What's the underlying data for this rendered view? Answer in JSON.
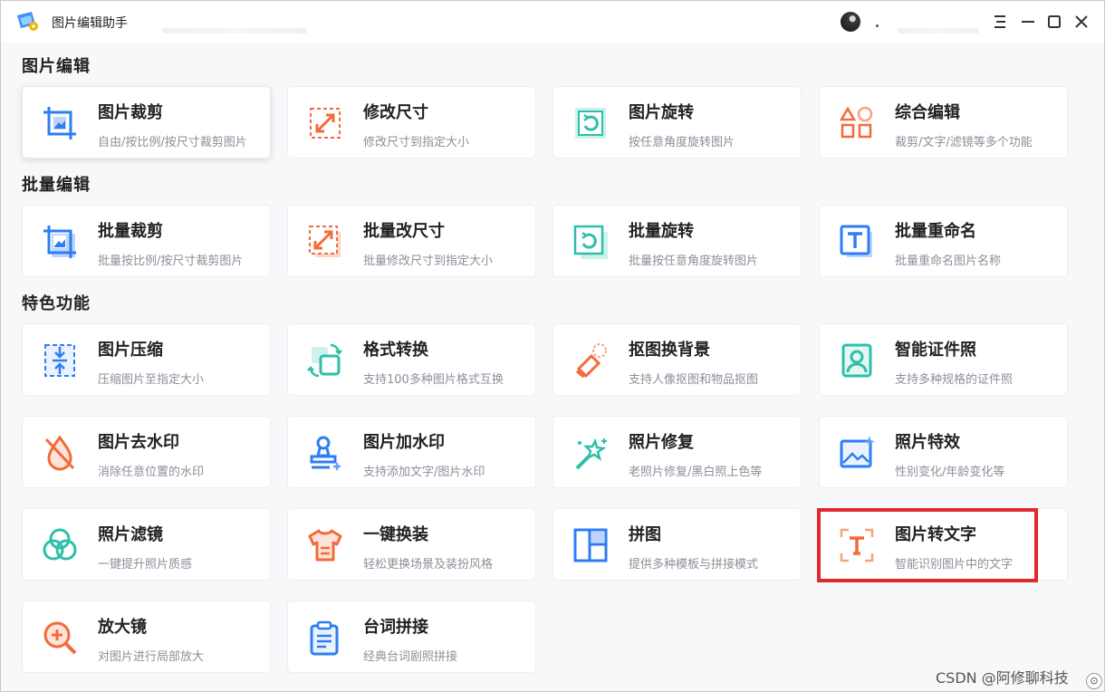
{
  "app": {
    "title": "图片编辑助手"
  },
  "sections": {
    "edit": "图片编辑",
    "batch": "批量编辑",
    "feature": "特色功能"
  },
  "cards": {
    "crop": {
      "title": "图片裁剪",
      "desc": "自由/按比例/按尺寸裁剪图片"
    },
    "resize": {
      "title": "修改尺寸",
      "desc": "修改尺寸到指定大小"
    },
    "rotate": {
      "title": "图片旋转",
      "desc": "按任意角度旋转图片"
    },
    "combo": {
      "title": "综合编辑",
      "desc": "裁剪/文字/滤镜等多个功能"
    },
    "batch_crop": {
      "title": "批量裁剪",
      "desc": "批量按比例/按尺寸裁剪图片"
    },
    "batch_resize": {
      "title": "批量改尺寸",
      "desc": "批量修改尺寸到指定大小"
    },
    "batch_rotate": {
      "title": "批量旋转",
      "desc": "批量按任意角度旋转图片"
    },
    "batch_rename": {
      "title": "批量重命名",
      "desc": "批量重命名图片名称"
    },
    "compress": {
      "title": "图片压缩",
      "desc": "压缩图片至指定大小"
    },
    "convert": {
      "title": "格式转换",
      "desc": "支持100多种图片格式互换"
    },
    "cutout": {
      "title": "抠图换背景",
      "desc": "支持人像抠图和物品抠图"
    },
    "idphoto": {
      "title": "智能证件照",
      "desc": "支持多种规格的证件照"
    },
    "unwatermark": {
      "title": "图片去水印",
      "desc": "消除任意位置的水印"
    },
    "addwatermark": {
      "title": "图片加水印",
      "desc": "支持添加文字/图片水印"
    },
    "repair": {
      "title": "照片修复",
      "desc": "老照片修复/黑白照上色等"
    },
    "effects": {
      "title": "照片特效",
      "desc": "性别变化/年龄变化等"
    },
    "filter": {
      "title": "照片滤镜",
      "desc": "一键提升照片质感"
    },
    "outfit": {
      "title": "一键换装",
      "desc": "轻松更换场景及装扮风格"
    },
    "collage": {
      "title": "拼图",
      "desc": "提供多种模板与拼接模式"
    },
    "ocr": {
      "title": "图片转文字",
      "desc": "智能识别图片中的文字"
    },
    "magnifier": {
      "title": "放大镜",
      "desc": "对图片进行局部放大"
    },
    "subtitle": {
      "title": "台词拼接",
      "desc": "经典台词剧照拼接"
    }
  },
  "watermark": "CSDN @阿修聊科技",
  "colors": {
    "blue": "#2e7cf6",
    "orange": "#f26b3a",
    "teal": "#2cc0a8",
    "highlight": "#e0282e"
  }
}
